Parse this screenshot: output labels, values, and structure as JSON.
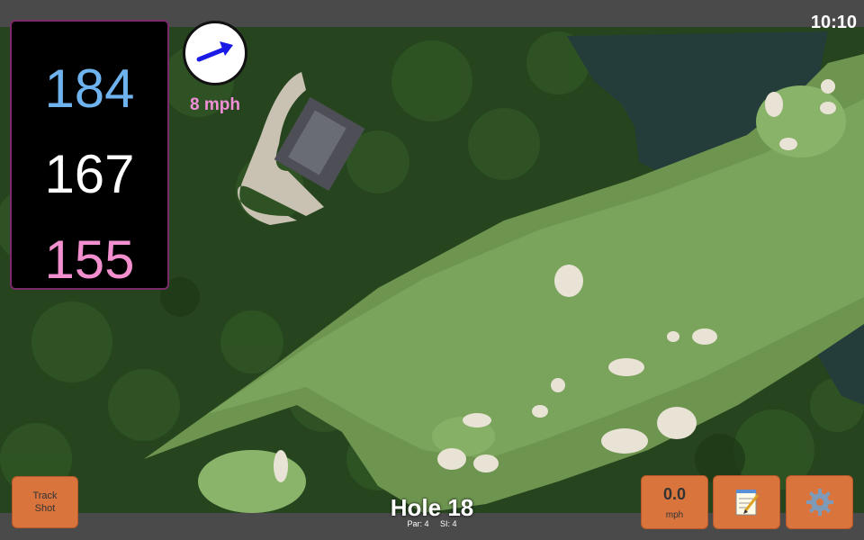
{
  "status_bar": {
    "time": "10:10"
  },
  "distances": {
    "back": "184",
    "center": "167",
    "front": "155"
  },
  "wind": {
    "speed_label": "8 mph",
    "direction_icon": "arrow-icon"
  },
  "hole": {
    "title": "Hole 18",
    "par": "Par: 4",
    "si": "SI: 4"
  },
  "buttons": {
    "track_line1": "Track",
    "track_line2": "Shot",
    "speed_value": "0.0",
    "speed_unit": "mph",
    "notes_icon": "notepad-icon",
    "settings_icon": "gear-icon"
  },
  "colors": {
    "back": "#6fb3ee",
    "center": "#ffffff",
    "front": "#f28fcf",
    "button": "#d9743d",
    "wind_text": "#f08fd8"
  }
}
